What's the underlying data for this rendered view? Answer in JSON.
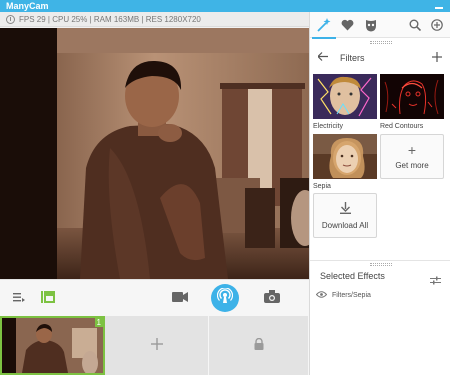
{
  "app": {
    "title": "ManyCam"
  },
  "status": {
    "text": "FPS 29 | CPU 25% | RAM 163MB | RES 1280X720"
  },
  "panel": {
    "section_title": "Filters",
    "filters": [
      {
        "label": "Electricity"
      },
      {
        "label": "Red Contours"
      },
      {
        "label": "Sepia"
      }
    ],
    "get_more_label": "Get more",
    "download_all_label": "Download All",
    "selected_effects_title": "Selected Effects",
    "selected_effects": [
      {
        "label": "Filters/Sepia"
      }
    ]
  },
  "thumbnails": {
    "active_badge": "1"
  },
  "colors": {
    "accent": "#3db2e8",
    "active_green": "#7dc242",
    "titlebar": "#3fb4e6"
  }
}
